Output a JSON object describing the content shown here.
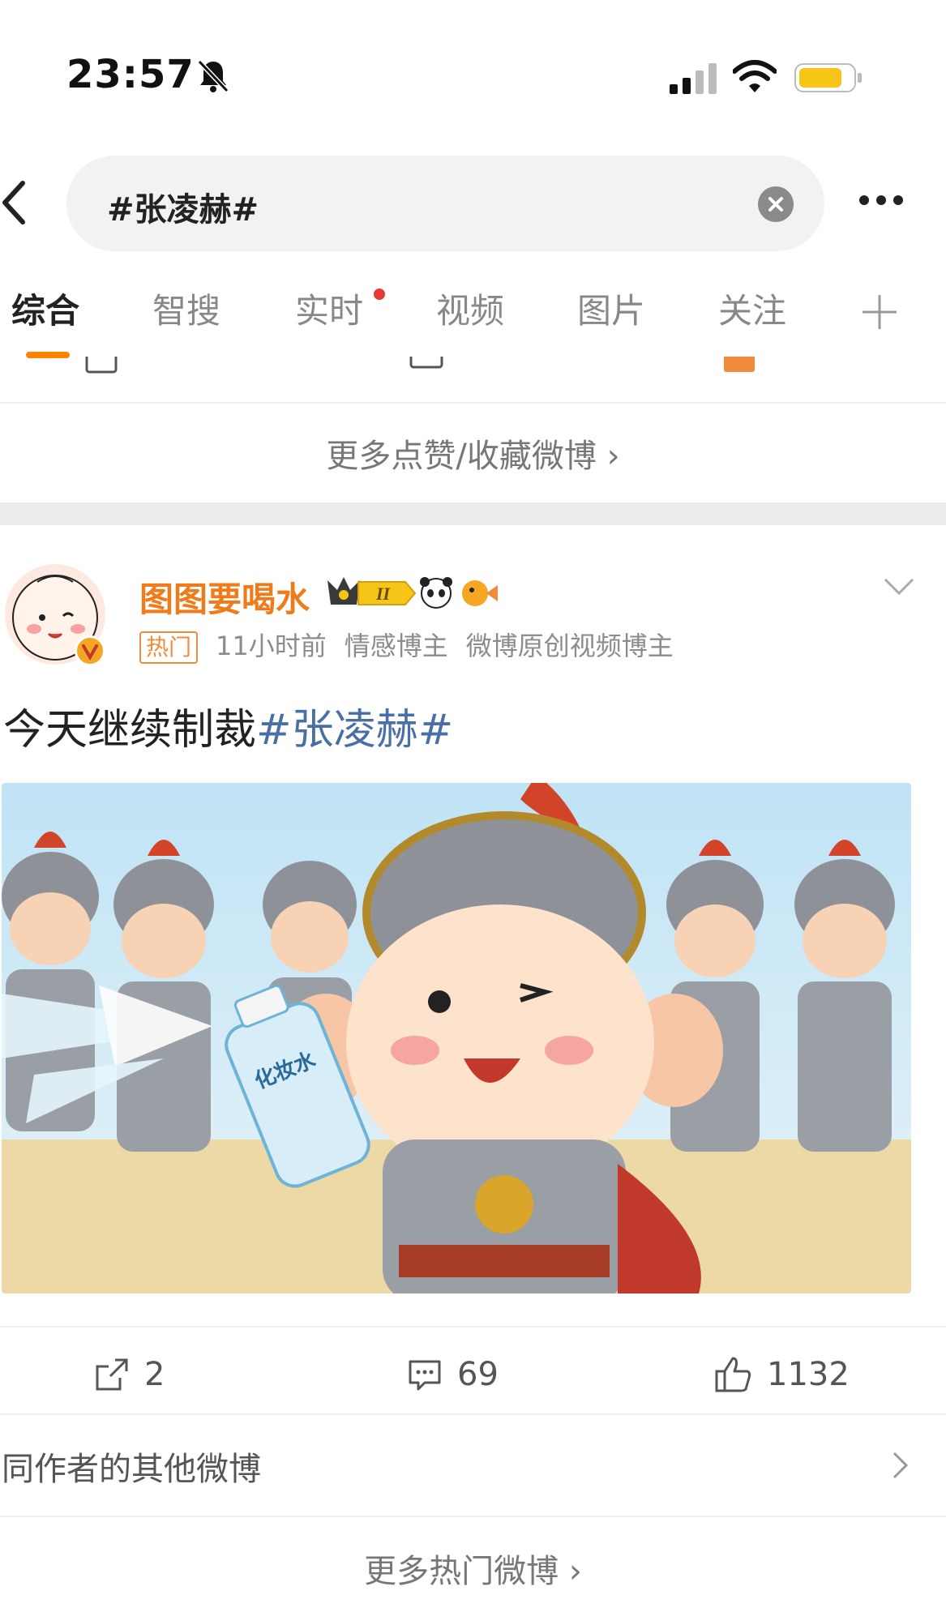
{
  "status_bar": {
    "time": "23:57"
  },
  "search": {
    "query": "#张凌赫#"
  },
  "tabs": [
    {
      "label": "综合",
      "active": true
    },
    {
      "label": "智搜"
    },
    {
      "label": "实时",
      "has_dot": true
    },
    {
      "label": "视频"
    },
    {
      "label": "图片"
    },
    {
      "label": "关注"
    }
  ],
  "section": {
    "more_liked": "更多点赞/收藏微博 ›"
  },
  "post": {
    "username": "图图要喝水",
    "level_badge": "II",
    "hot_tag": "热门",
    "time": "11小时前",
    "categories": [
      "情感博主",
      "微博原创视频博主"
    ],
    "text_prefix": "今天继续制裁",
    "hashtag": "#张凌赫#",
    "image_bottle_label": "化妆水",
    "actions": {
      "repost": "2",
      "comment": "69",
      "like": "1132"
    },
    "other_by_author": "同作者的其他微博"
  },
  "footer": {
    "more_hot": "更多热门微博 ›"
  },
  "colors": {
    "accent": "#ff8200",
    "username": "#f07b1a",
    "hashtag": "#4a6fa5",
    "battery": "#f5c518"
  }
}
